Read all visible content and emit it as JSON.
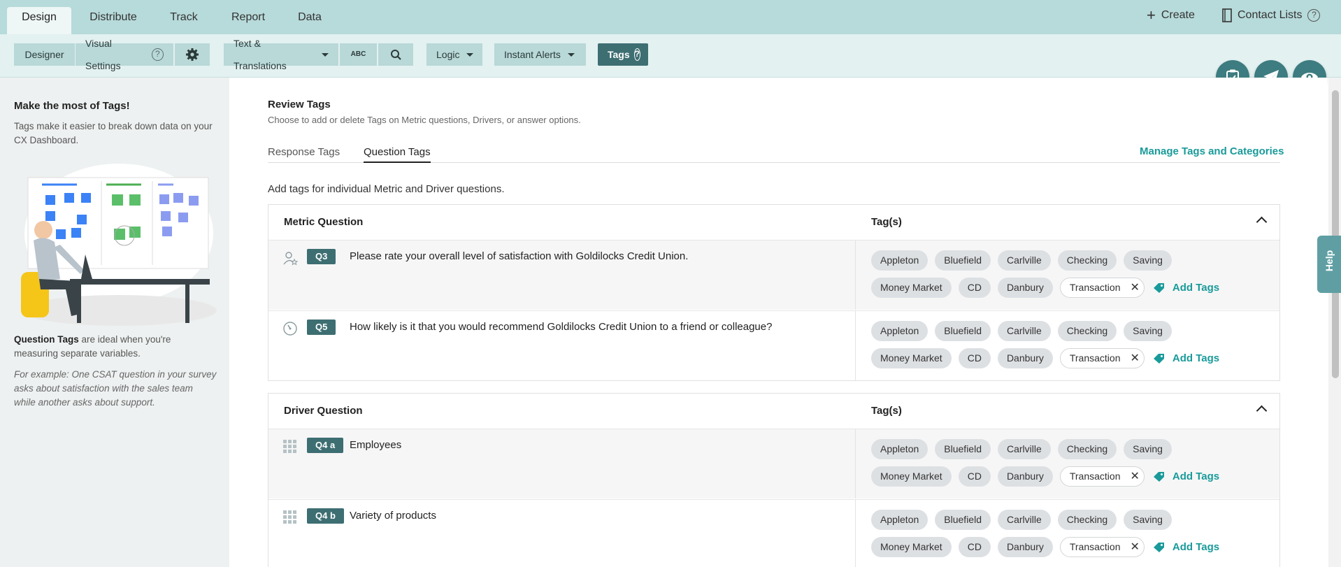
{
  "topnav": {
    "tabs": [
      {
        "label": "Design",
        "active": true
      },
      {
        "label": "Distribute",
        "active": false
      },
      {
        "label": "Track",
        "active": false
      },
      {
        "label": "Report",
        "active": false
      },
      {
        "label": "Data",
        "active": false
      }
    ],
    "create_label": "Create",
    "contact_lists_label": "Contact Lists"
  },
  "toolbar": {
    "designer": "Designer",
    "visual_settings": "Visual Settings",
    "text_translations": "Text & Translations",
    "spell_check": "ABC",
    "logic": "Logic",
    "instant_alerts": "Instant Alerts",
    "tags": "Tags"
  },
  "left": {
    "heading": "Make the most of Tags!",
    "intro": "Tags make it easier to break down data on your CX Dashboard.",
    "qt_bold": "Question Tags",
    "qt_rest": " are ideal when you're measuring separate variables.",
    "example": "For example: One CSAT question in your survey asks about satisfaction with the sales team while another asks about support."
  },
  "main": {
    "title": "Review Tags",
    "subtitle": "Choose to add or delete Tags on Metric questions, Drivers, or answer options.",
    "tabs": [
      "Response Tags",
      "Question Tags"
    ],
    "manage_link": "Manage Tags and Categories",
    "instruction": "Add tags for individual Metric and Driver questions.",
    "metric_section": {
      "col1": "Metric Question",
      "col2": "Tag(s)",
      "rows": [
        {
          "badge": "Q3",
          "icon": "person-star-icon",
          "text": "Please rate your overall level of satisfaction with Goldilocks Credit Union."
        },
        {
          "badge": "Q5",
          "icon": "gauge-icon",
          "text": "How likely is it that you would recommend Goldilocks Credit Union to a friend or colleague?"
        }
      ]
    },
    "driver_section": {
      "col1": "Driver Question",
      "col2": "Tag(s)",
      "rows": [
        {
          "badge": "Q4 a",
          "icon": "grid-icon",
          "text": "Employees"
        },
        {
          "badge": "Q4 b",
          "icon": "grid-icon",
          "text": "Variety of products"
        }
      ]
    },
    "tag_row1": [
      "Appleton",
      "Bluefield",
      "Carlville",
      "Checking",
      "Saving"
    ],
    "tag_row2": [
      "Money Market",
      "CD",
      "Danbury"
    ],
    "selected_tag": "Transaction",
    "add_tags": "Add Tags"
  },
  "help_label": "Help",
  "colors": {
    "accent": "#1a9a9a",
    "badge": "#3d6e72",
    "nav": "#b7dada"
  }
}
